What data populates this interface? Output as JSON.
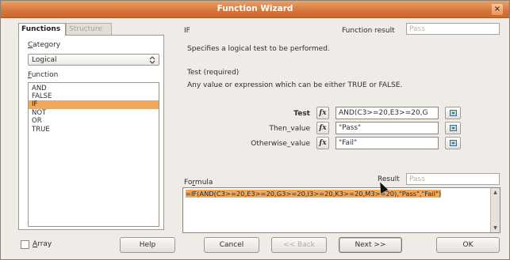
{
  "window": {
    "title": "Function Wizard",
    "close_glyph": "×"
  },
  "tabs": [
    {
      "label": "Functions",
      "active": true
    },
    {
      "label": "Structure",
      "active": false
    }
  ],
  "category": {
    "label": "Category",
    "accel": "C",
    "value": "Logical"
  },
  "function_list": {
    "label": "Function",
    "accel": "F",
    "items": [
      "AND",
      "FALSE",
      "IF",
      "NOT",
      "OR",
      "TRUE"
    ],
    "selected_index": 2
  },
  "function_panel": {
    "name": "IF",
    "result_label": "Function result",
    "result_value": "Pass",
    "description": "Specifies a logical test to be performed.",
    "arg_title": "Test (required)",
    "arg_description": "Any value or expression which can be either TRUE or FALSE."
  },
  "arguments": [
    {
      "label": "Test",
      "bold": true,
      "value": "AND(C3>=20,E3>=20,G"
    },
    {
      "label": "Then_value",
      "bold": false,
      "value": "\"Pass\""
    },
    {
      "label": "Otherwise_value",
      "bold": false,
      "value": "\"Fail\""
    }
  ],
  "fx_label": "fx",
  "formula": {
    "label": "Formula",
    "accel": "r",
    "result_label": "Result",
    "result_value": "Pass",
    "text": "=IF(AND(C3>=20,E3>=20,G3>=20,I3>=20,K3>=20,M3>=20),\"Pass\",\"Fail\")"
  },
  "array_checkbox": {
    "label": "Array",
    "checked": false
  },
  "buttons": {
    "help": "Help",
    "cancel": "Cancel",
    "back": "<< Back",
    "next": "Next >>",
    "ok": "OK"
  },
  "colors": {
    "titlebar": "#d9783b",
    "selection": "#f1a858"
  },
  "icons": [
    "close-icon",
    "chevron-updown-icon",
    "fx-icon",
    "shrink-icon",
    "mouse-cursor-icon"
  ]
}
